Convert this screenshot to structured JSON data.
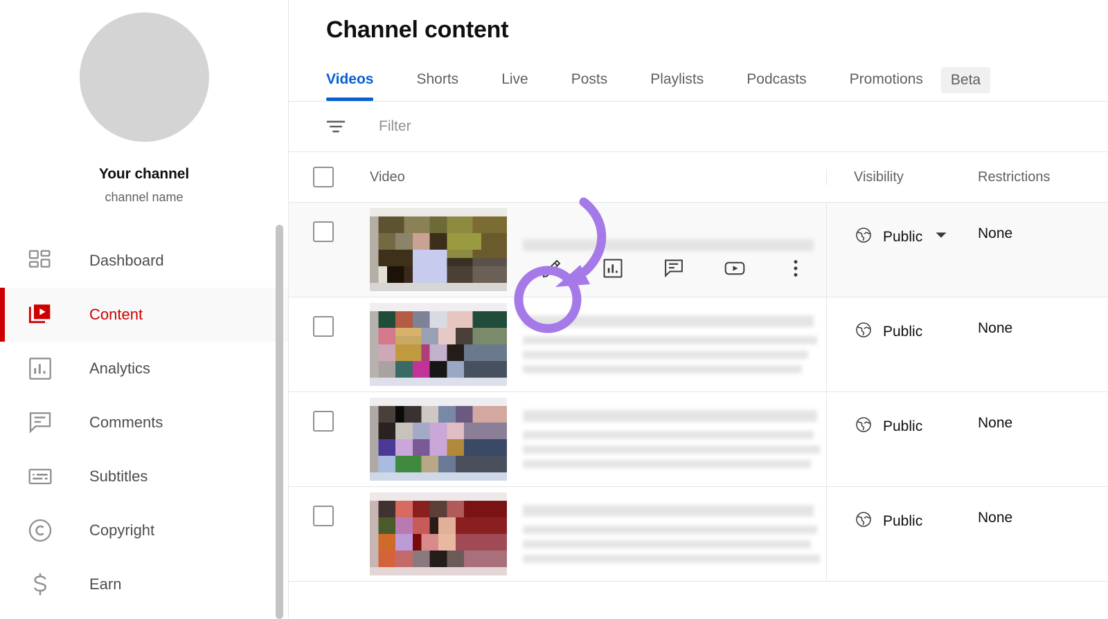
{
  "sidebar": {
    "channel": {
      "title": "Your channel",
      "subtitle": "channel name",
      "avatar_color": "#d4d4d4"
    },
    "items": [
      {
        "id": "dashboard",
        "label": "Dashboard",
        "icon": "dashboard-grid-icon",
        "active": false
      },
      {
        "id": "content",
        "label": "Content",
        "icon": "content-video-stack-icon",
        "active": true
      },
      {
        "id": "analytics",
        "label": "Analytics",
        "icon": "analytics-bar-chart-icon",
        "active": false
      },
      {
        "id": "comments",
        "label": "Comments",
        "icon": "comment-bubble-icon",
        "active": false
      },
      {
        "id": "subtitles",
        "label": "Subtitles",
        "icon": "subtitles-icon",
        "active": false
      },
      {
        "id": "copyright",
        "label": "Copyright",
        "icon": "copyright-circle-icon",
        "active": false
      },
      {
        "id": "earn",
        "label": "Earn",
        "icon": "dollar-sign-icon",
        "active": false
      }
    ],
    "active_color": "#cc0000"
  },
  "header": {
    "title": "Channel content"
  },
  "tabs": {
    "active_color": "#065fd4",
    "items": [
      {
        "id": "videos",
        "label": "Videos",
        "active": true
      },
      {
        "id": "shorts",
        "label": "Shorts",
        "active": false
      },
      {
        "id": "live",
        "label": "Live",
        "active": false
      },
      {
        "id": "posts",
        "label": "Posts",
        "active": false
      },
      {
        "id": "playlists",
        "label": "Playlists",
        "active": false
      },
      {
        "id": "podcasts",
        "label": "Podcasts",
        "active": false
      },
      {
        "id": "promotions",
        "label": "Promotions",
        "active": false
      }
    ],
    "badge": "Beta"
  },
  "filter": {
    "placeholder": "Filter",
    "value": "",
    "icon": "filter-lines-icon"
  },
  "table": {
    "columns": {
      "video": "Video",
      "visibility": "Visibility",
      "restrictions": "Restrictions"
    },
    "row_actions": [
      {
        "id": "edit",
        "icon": "pencil-edit-icon",
        "label": "Details"
      },
      {
        "id": "analytics",
        "icon": "analytics-bar-icon",
        "label": "Analytics"
      },
      {
        "id": "comments",
        "icon": "comment-bubble-icon",
        "label": "Comments"
      },
      {
        "id": "youtube",
        "icon": "youtube-play-icon",
        "label": "Get shareable link"
      },
      {
        "id": "more",
        "icon": "more-vertical-dots-icon",
        "label": "Options"
      }
    ],
    "rows": [
      {
        "id": "row-1",
        "visibility": "Public",
        "visibility_icon": "globe-icon",
        "has_caret": true,
        "restrictions": "None",
        "hovered": true,
        "title_redacted": true,
        "thumb_palette": [
          "#6b6040",
          "#8a7a4a",
          "#3b2d1a",
          "#a8a088",
          "#c6cbe2",
          "#9aa0b8",
          "#7d8c3e",
          "#2f2a18"
        ]
      },
      {
        "id": "row-2",
        "visibility": "Public",
        "visibility_icon": "globe-icon",
        "has_caret": false,
        "restrictions": "None",
        "hovered": false,
        "title_redacted": true,
        "thumb_palette": [
          "#1f4d3a",
          "#b45b45",
          "#d8b26a",
          "#c9a2b8",
          "#e6c6cc",
          "#8f96b4",
          "#4a3f52",
          "#2a6652"
        ]
      },
      {
        "id": "row-3",
        "visibility": "Public",
        "visibility_icon": "globe-icon",
        "has_caret": false,
        "restrictions": "None",
        "hovered": false,
        "title_redacted": true,
        "thumb_palette": [
          "#3a3330",
          "#1a1a1a",
          "#c9a7d8",
          "#7a6fb0",
          "#5a8fc0",
          "#3f8a3f",
          "#d9c2cf",
          "#8a7a86"
        ]
      },
      {
        "id": "row-4",
        "visibility": "Public",
        "visibility_icon": "globe-icon",
        "has_caret": false,
        "restrictions": "None",
        "hovered": false,
        "title_redacted": true,
        "thumb_palette": [
          "#8a1f1f",
          "#c94b45",
          "#e0847a",
          "#b87ab0",
          "#5a4038",
          "#d86a3a",
          "#3a2a28",
          "#e0a898"
        ]
      }
    ]
  },
  "annotation": {
    "color": "#a57ae8",
    "shapes": [
      "circle-highlight-around-edit-icon",
      "curved-arrow-pointing-to-edit-icon"
    ]
  }
}
